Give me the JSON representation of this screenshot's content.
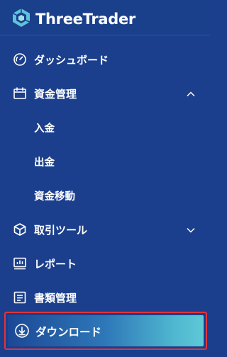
{
  "brand": {
    "name": "ThreeTrader"
  },
  "menu": {
    "dashboard": "ダッシュボード",
    "funds": "資金管理",
    "deposit": "入金",
    "withdraw": "出金",
    "transfer": "資金移動",
    "trading": "取引ツール",
    "reports": "レポート",
    "documents": "書類管理",
    "download": "ダウンロード"
  },
  "colors": {
    "sidebar_bg": "#1b3f8c",
    "active_gradient_end": "#5ec9d6",
    "highlight_border": "#e0343a"
  }
}
